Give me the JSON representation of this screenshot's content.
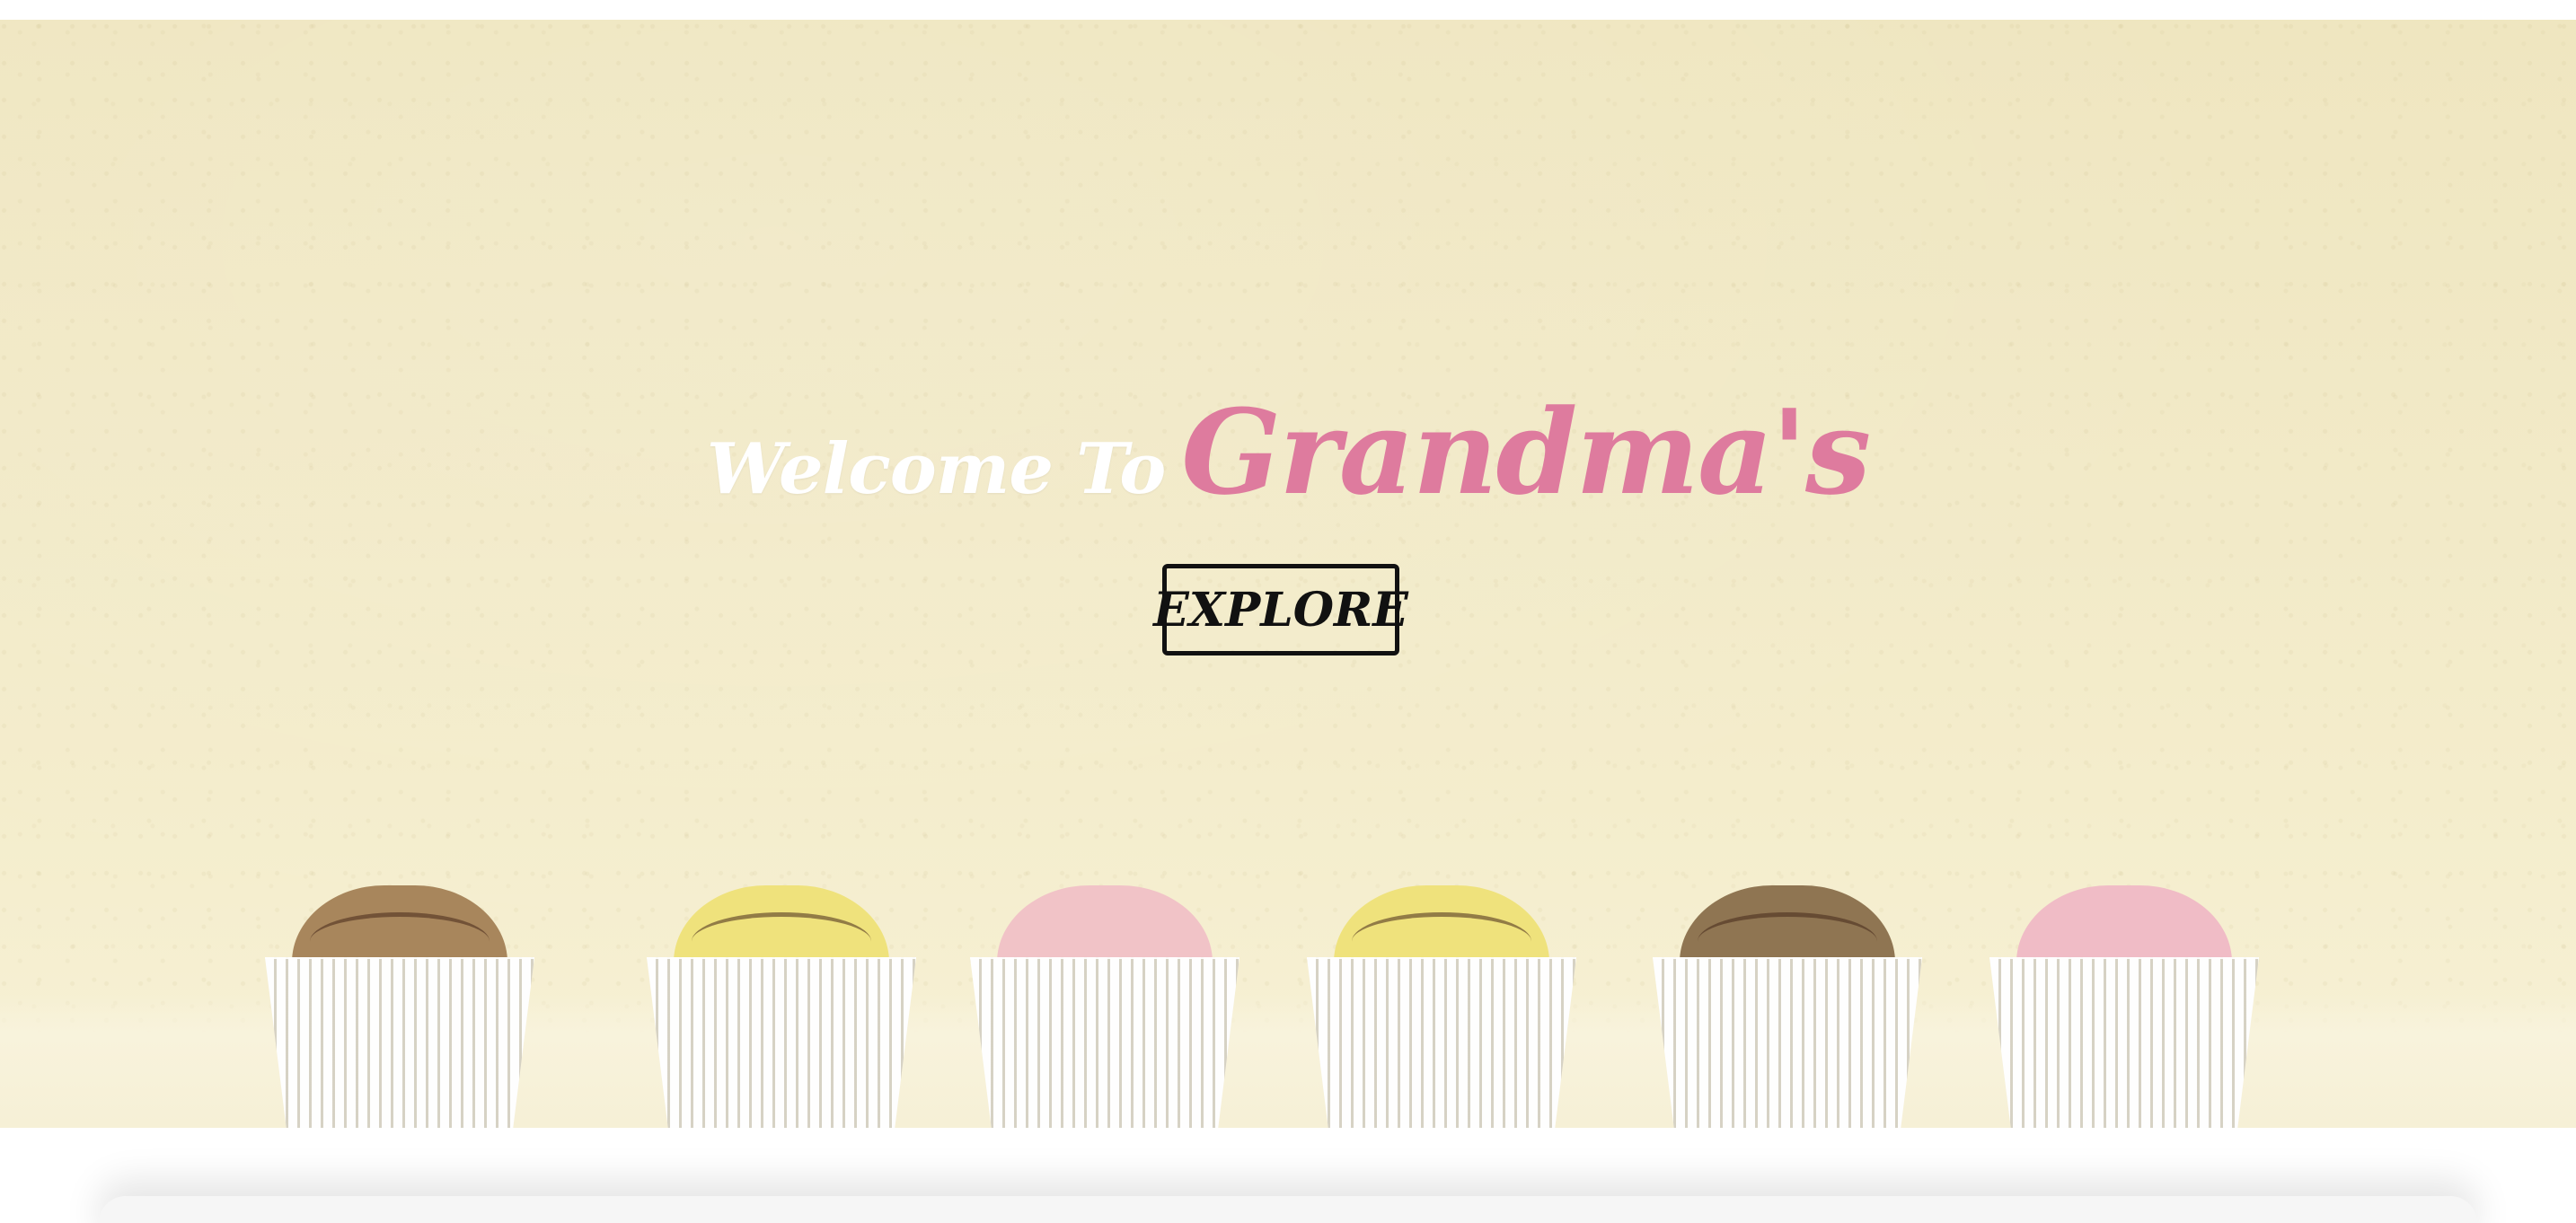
{
  "hero": {
    "welcome_text": "Welcome To",
    "brand_text": "Grandma's",
    "explore_label": "EXPLORE"
  },
  "colors": {
    "background": "#f2eac8",
    "welcome": "#ffffff",
    "brand": "#de7b9e",
    "button_border": "#111111"
  },
  "cupcakes": [
    {
      "frosting": "chocolate",
      "color": "#a8865c"
    },
    {
      "frosting": "lemon",
      "color": "#efe27c"
    },
    {
      "frosting": "strawberry",
      "color": "#f1c3c7"
    },
    {
      "frosting": "lemon",
      "color": "#efe27c"
    },
    {
      "frosting": "chocolate",
      "color": "#8f7552"
    },
    {
      "frosting": "strawberry",
      "color": "#f0bcc6"
    }
  ]
}
